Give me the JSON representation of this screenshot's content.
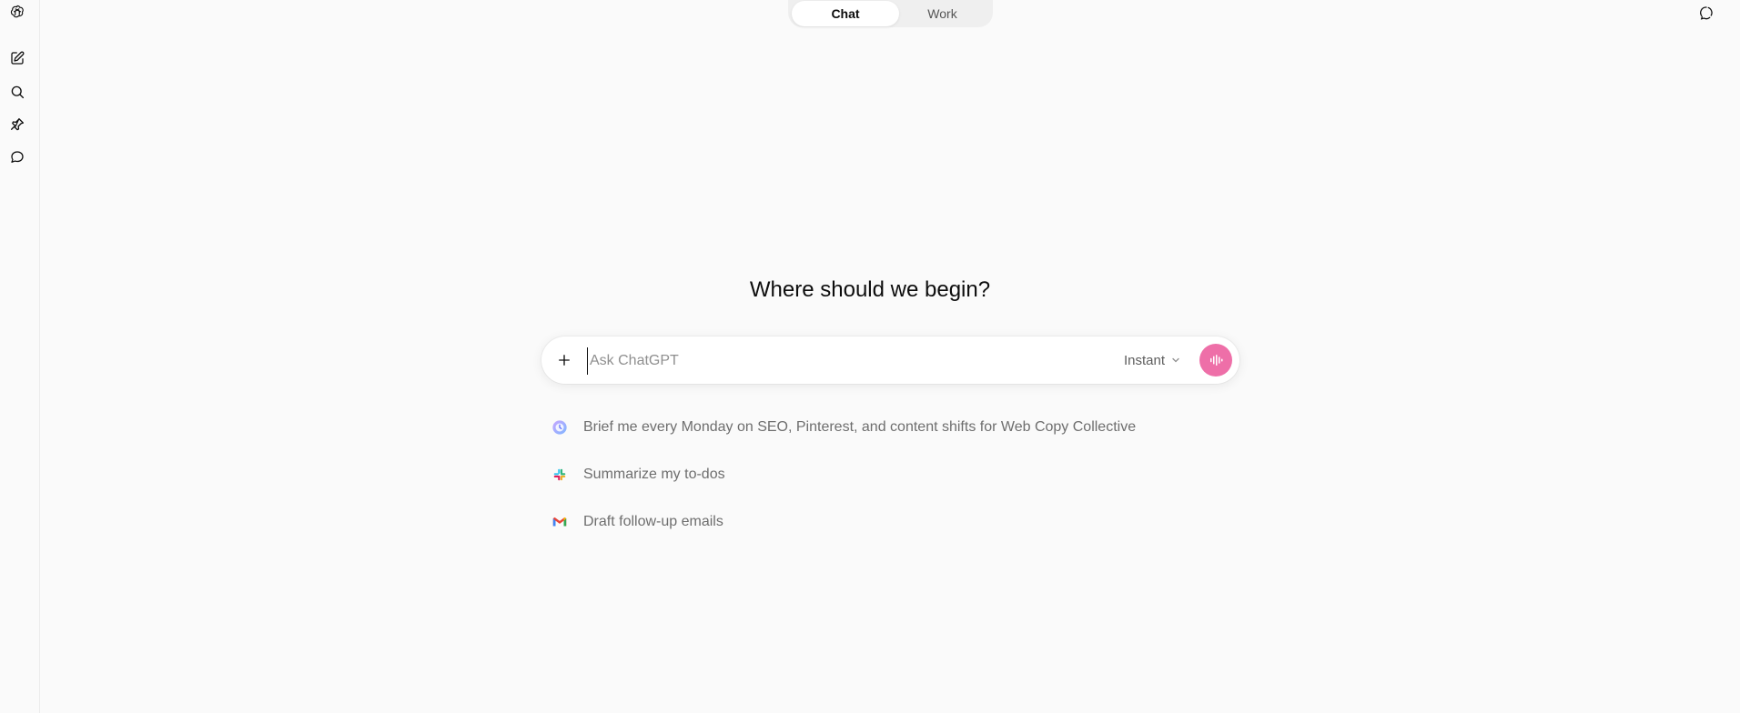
{
  "toggle": {
    "chat_label": "Chat",
    "work_label": "Work"
  },
  "heading": "Where should we begin?",
  "composer": {
    "placeholder": "Ask ChatGPT",
    "model_label": "Instant",
    "voice_color": "#ee6fa8"
  },
  "suggestions": [
    {
      "icon": "scheduled-task-icon",
      "text": "Brief me every Monday on SEO, Pinterest, and content shifts for Web Copy Collective"
    },
    {
      "icon": "slack-icon",
      "text": "Summarize my to-dos"
    },
    {
      "icon": "gmail-icon",
      "text": "Draft follow-up emails"
    }
  ],
  "sidebar": {
    "items": [
      {
        "icon": "openai-logo-icon"
      },
      {
        "icon": "new-chat-icon"
      },
      {
        "icon": "search-icon"
      },
      {
        "icon": "pin-icon"
      },
      {
        "icon": "chats-icon"
      }
    ]
  }
}
